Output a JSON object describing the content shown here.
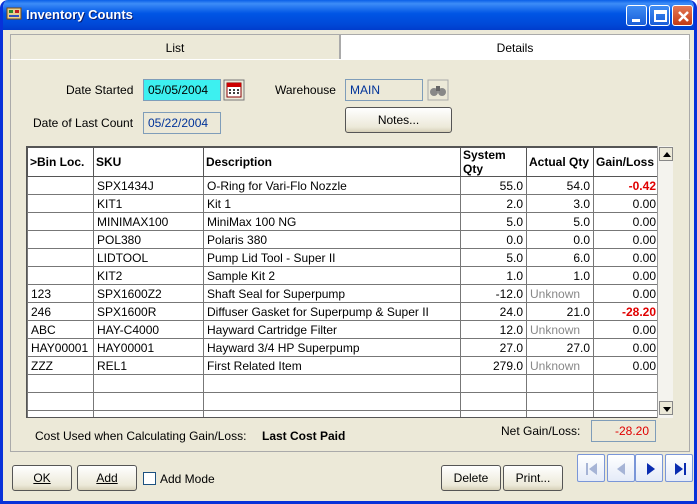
{
  "window": {
    "title": "Inventory Counts"
  },
  "tabs": [
    {
      "label": "List"
    },
    {
      "label": "Details"
    }
  ],
  "form": {
    "date_started_label": "Date Started",
    "date_started_value": "05/05/2004",
    "last_count_label": "Date of Last Count",
    "last_count_value": "05/22/2004",
    "warehouse_label": "Warehouse",
    "warehouse_value": "MAIN",
    "notes_label": "Notes..."
  },
  "grid": {
    "columns": [
      ">Bin Loc.",
      "SKU",
      "Description",
      "System Qty",
      "Actual Qty",
      "Gain/Loss"
    ],
    "rows": [
      {
        "bin": "",
        "sku": "SPX1434J",
        "desc": "O-Ring for Vari-Flo Nozzle",
        "sys": "55.0",
        "act": "54.0",
        "gain": "-0.42"
      },
      {
        "bin": "",
        "sku": "KIT1",
        "desc": "Kit 1",
        "sys": "2.0",
        "act": "3.0",
        "gain": "0.00"
      },
      {
        "bin": "",
        "sku": "MINIMAX100",
        "desc": "MiniMax 100 NG",
        "sys": "5.0",
        "act": "5.0",
        "gain": "0.00"
      },
      {
        "bin": "",
        "sku": "POL380",
        "desc": "Polaris 380",
        "sys": "0.0",
        "act": "0.0",
        "gain": "0.00"
      },
      {
        "bin": "",
        "sku": "LIDTOOL",
        "desc": "Pump Lid Tool - Super II",
        "sys": "5.0",
        "act": "6.0",
        "gain": "0.00"
      },
      {
        "bin": "",
        "sku": "KIT2",
        "desc": "Sample Kit 2",
        "sys": "1.0",
        "act": "1.0",
        "gain": "0.00"
      },
      {
        "bin": "123",
        "sku": "SPX1600Z2",
        "desc": "Shaft Seal for Superpump",
        "sys": "-12.0",
        "act": "Unknown",
        "gain": "0.00"
      },
      {
        "bin": "246",
        "sku": "SPX1600R",
        "desc": "Diffuser Gasket for Superpump & Super II",
        "sys": "24.0",
        "act": "21.0",
        "gain": "-28.20"
      },
      {
        "bin": "ABC",
        "sku": "HAY-C4000",
        "desc": "Hayward Cartridge Filter",
        "sys": "12.0",
        "act": "Unknown",
        "gain": "0.00"
      },
      {
        "bin": "HAY00001",
        "sku": "HAY00001",
        "desc": "Hayward 3/4 HP Superpump",
        "sys": "27.0",
        "act": "27.0",
        "gain": "0.00"
      },
      {
        "bin": "ZZZ",
        "sku": "REL1",
        "desc": "First Related Item",
        "sys": "279.0",
        "act": "Unknown",
        "gain": "0.00"
      },
      {
        "bin": "",
        "sku": "",
        "desc": "",
        "sys": "",
        "act": "",
        "gain": ""
      },
      {
        "bin": "",
        "sku": "",
        "desc": "",
        "sys": "",
        "act": "",
        "gain": ""
      },
      {
        "bin": "",
        "sku": "",
        "desc": "",
        "sys": "",
        "act": "",
        "gain": ""
      }
    ]
  },
  "footer": {
    "cost_label": "Cost Used when Calculating Gain/Loss:",
    "cost_value": "Last Cost Paid",
    "net_label": "Net Gain/Loss:",
    "net_value": "-28.20"
  },
  "buttons": {
    "ok": "OK",
    "add": "Add",
    "add_mode": "Add Mode",
    "delete": "Delete",
    "print": "Print..."
  },
  "colors": {
    "title_bar": "#0055e5",
    "date_highlight": "#3df0f0",
    "negative": "#e00000"
  }
}
